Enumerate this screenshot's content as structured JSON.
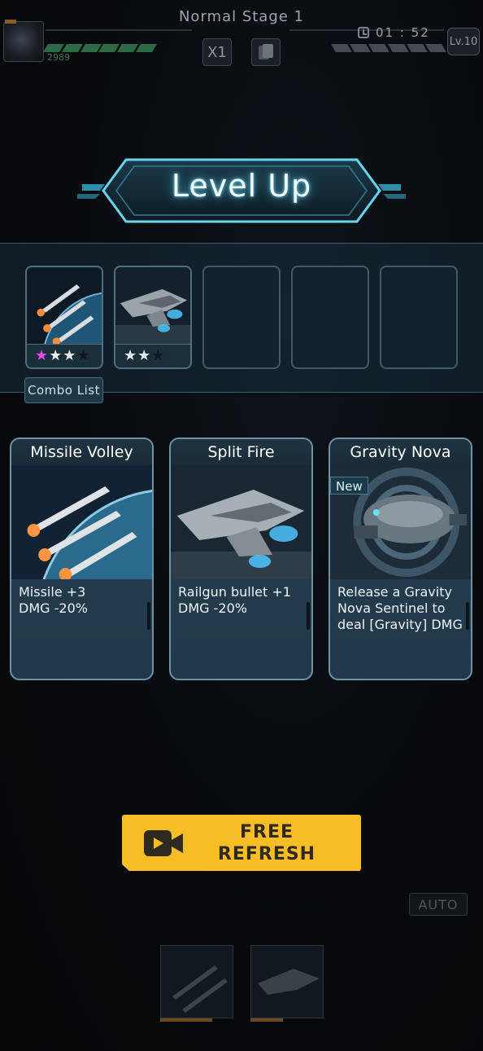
{
  "hud": {
    "stage_title": "Normal Stage 1",
    "score": "2989",
    "speed_label": "X1",
    "timer": "01 : 52",
    "level_badge": "Lv.10",
    "icons": [
      "avatar",
      "speed-button",
      "cards-icon",
      "clock-icon"
    ]
  },
  "banner": {
    "title": "Level Up",
    "glow_color": "#5ad8ff"
  },
  "combo": {
    "tab_label": "Combo List",
    "slots": [
      {
        "name": "missile-volley",
        "stars": [
          "pink",
          "white",
          "white",
          "dark"
        ]
      },
      {
        "name": "split-fire",
        "stars": [
          "white",
          "white",
          "dark"
        ]
      },
      {
        "name": "empty"
      },
      {
        "name": "empty"
      },
      {
        "name": "empty"
      }
    ]
  },
  "cards": [
    {
      "title": "Missile Volley",
      "desc": "Missile +3\nDMG -20%",
      "new": false
    },
    {
      "title": "Split Fire",
      "desc": "Railgun bullet +1\nDMG -20%",
      "new": false
    },
    {
      "title": "Gravity Nova",
      "desc": "Release a Gravity Nova Sentinel to deal [Gravity] DMG",
      "new": true,
      "new_label": "New"
    }
  ],
  "refresh": {
    "label_line1": "FREE",
    "label_line2": "REFRESH",
    "icon": "video-camera-icon",
    "color": "#f6bd24"
  },
  "auto_label": "AUTO",
  "colors": {
    "accent": "#5ad8ff",
    "card_border": "#6d93a6",
    "star_pink": "#e04ce6"
  }
}
